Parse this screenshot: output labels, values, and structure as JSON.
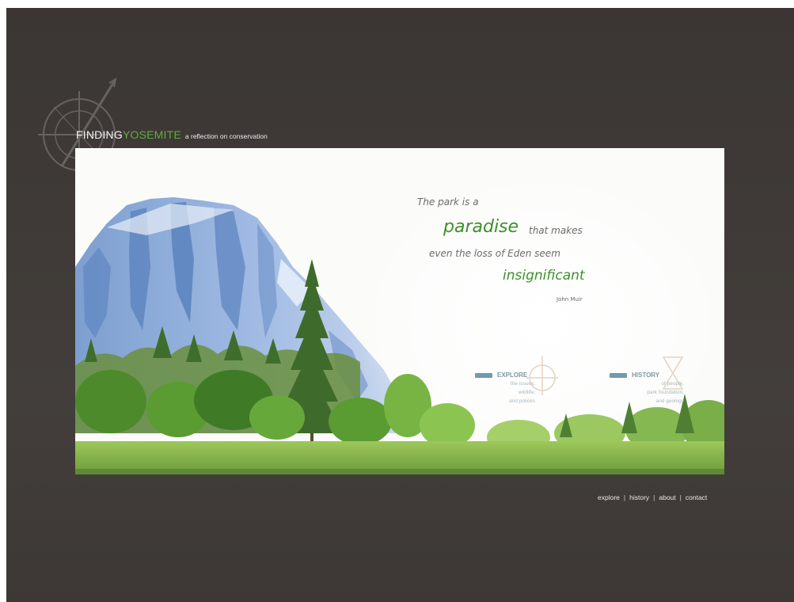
{
  "brand": {
    "word1": "FINDING",
    "word2": "YOSEMITE",
    "tagline": "a reflection on conservation"
  },
  "quote": {
    "line1": "The park is a",
    "emphasis1": "paradise",
    "line2": "that makes",
    "line3": "even the loss of Eden seem",
    "emphasis2": "insignificant",
    "author": "John Muir"
  },
  "sections": {
    "explore": {
      "title": "EXPLORE",
      "lines": [
        "the issues,",
        "wildlife,",
        "and polices"
      ]
    },
    "history": {
      "title": "HISTORY",
      "lines": [
        "of people,",
        "park foundation,",
        "and geology"
      ]
    }
  },
  "footer": {
    "links": [
      "explore",
      "history",
      "about",
      "contact"
    ],
    "separator": "|"
  },
  "colors": {
    "background": "#3f3a37",
    "accent_green": "#5fae3c",
    "quote_green": "#3d8f2b",
    "nav_blue": "#6f9bab"
  }
}
